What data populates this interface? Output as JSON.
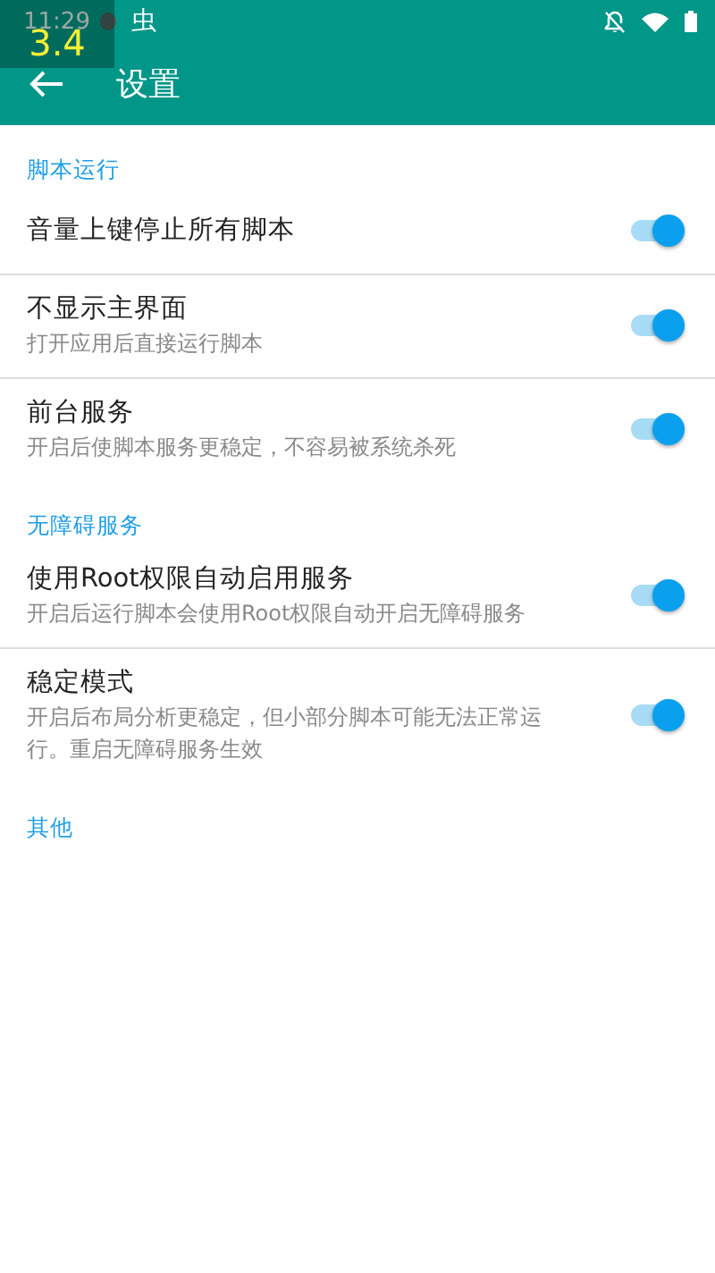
{
  "status_bar": {
    "time": "11:29",
    "notification": "虫"
  },
  "overlay": {
    "text": "3.4"
  },
  "toolbar": {
    "title": "设置"
  },
  "sections": [
    {
      "title": "脚本运行",
      "items": [
        {
          "title": "音量上键停止所有脚本",
          "on": true
        },
        {
          "title": "不显示主界面",
          "summary": "打开应用后直接运行脚本",
          "on": true
        },
        {
          "title": "前台服务",
          "summary": "开启后使脚本服务更稳定，不容易被系统杀死",
          "on": true
        }
      ]
    },
    {
      "title": "无障碍服务",
      "items": [
        {
          "title": "使用Root权限自动启用服务",
          "summary": "开启后运行脚本会使用Root权限自动开启无障碍服务",
          "on": true
        },
        {
          "title": "稳定模式",
          "summary": "开启后布局分析更稳定，但小部分脚本可能无法正常运行。重启无障碍服务生效",
          "on": true
        }
      ]
    },
    {
      "title": "其他"
    }
  ]
}
